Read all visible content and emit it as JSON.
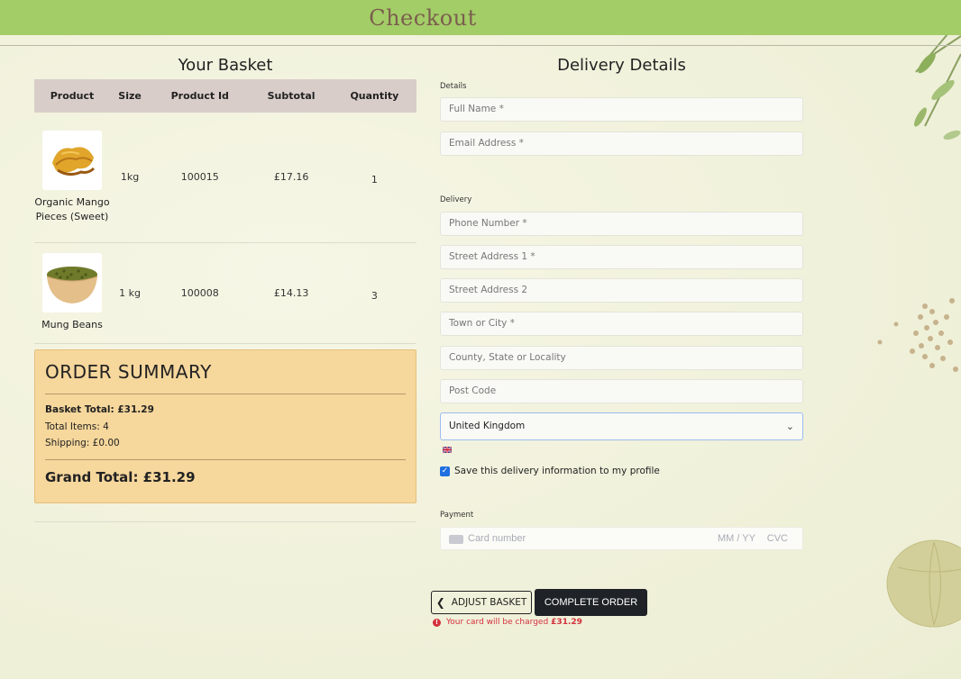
{
  "header": {
    "title": "Checkout"
  },
  "basket": {
    "title": "Your Basket",
    "columns": [
      "Product",
      "Size",
      "Product Id",
      "Subtotal",
      "Quantity"
    ],
    "rows": [
      {
        "name": "Organic Mango Pieces (Sweet)",
        "size": "1kg",
        "id": "100015",
        "subtotal": "£17.16",
        "quantity": "1"
      },
      {
        "name": "Mung Beans",
        "size": "1 kg",
        "id": "100008",
        "subtotal": "£14.13",
        "quantity": "3"
      }
    ]
  },
  "summary": {
    "title": "ORDER SUMMARY",
    "basket_total": "Basket Total: £31.29",
    "total_items": "Total Items: 4",
    "shipping": "Shipping: £0.00",
    "grand_total": "Grand Total: £31.29"
  },
  "delivery": {
    "title": "Delivery Details",
    "details_label": "Details",
    "full_name_placeholder": "Full Name *",
    "email_placeholder": "Email Address *",
    "delivery_label": "Delivery",
    "phone_placeholder": "Phone Number *",
    "street1_placeholder": "Street Address 1 *",
    "street2_placeholder": "Street Address 2",
    "town_placeholder": "Town or City *",
    "county_placeholder": "County, State or Locality",
    "postcode_placeholder": "Post Code",
    "country": "United Kingdom",
    "save_label": "Save this delivery information to my profile",
    "save_checked": true
  },
  "payment": {
    "label": "Payment",
    "card_placeholder": "Card number",
    "expiry_placeholder": "MM / YY",
    "cvc_placeholder": "CVC"
  },
  "actions": {
    "adjust_label": "ADJUST BASKET",
    "complete_label": "COMPLETE ORDER",
    "charge_text": "Your card will be charged",
    "charge_amount": "£31.29"
  },
  "colors": {
    "header_bg": "#a3cd67",
    "header_text": "#7b5e4e",
    "summary_bg": "#f6d79c",
    "table_header_bg": "#d9cdc9",
    "complete_button_bg": "#1f2327",
    "error": "#d3303c",
    "checkbox": "#1f6fe0"
  }
}
